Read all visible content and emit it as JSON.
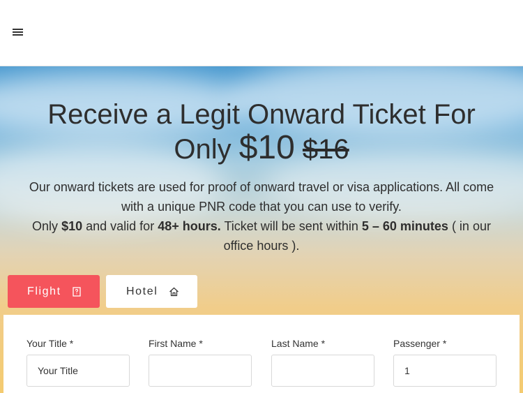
{
  "header": {
    "menu_icon": "hamburger-menu-icon"
  },
  "hero": {
    "headline_line1": "Receive a Legit Onward Ticket For",
    "headline_only": "Only",
    "price_now": "$10",
    "price_old": "$16",
    "desc_line1": "Our onward tickets are used for proof of onward travel or visa applications. All come with a unique PNR code that you can use to verify.",
    "desc_only": "Only",
    "desc_price": "$10",
    "desc_valid": "and valid for",
    "desc_hours": "48+ hours.",
    "desc_sent": "Ticket will be sent within",
    "desc_minutes": "5 – 60 minutes",
    "desc_office": "( in our office hours )."
  },
  "tabs": [
    {
      "label": "Flight",
      "icon": "document-icon",
      "active": true,
      "color": "#f5545c"
    },
    {
      "label": "Hotel",
      "icon": "home-icon",
      "active": false
    }
  ],
  "form": {
    "fields": [
      {
        "label": "Your Title *",
        "value": "Your Title",
        "placeholder": ""
      },
      {
        "label": "First Name *",
        "value": "",
        "placeholder": ""
      },
      {
        "label": "Last Name *",
        "value": "",
        "placeholder": ""
      },
      {
        "label": "Passenger *",
        "value": "1",
        "placeholder": ""
      }
    ]
  }
}
